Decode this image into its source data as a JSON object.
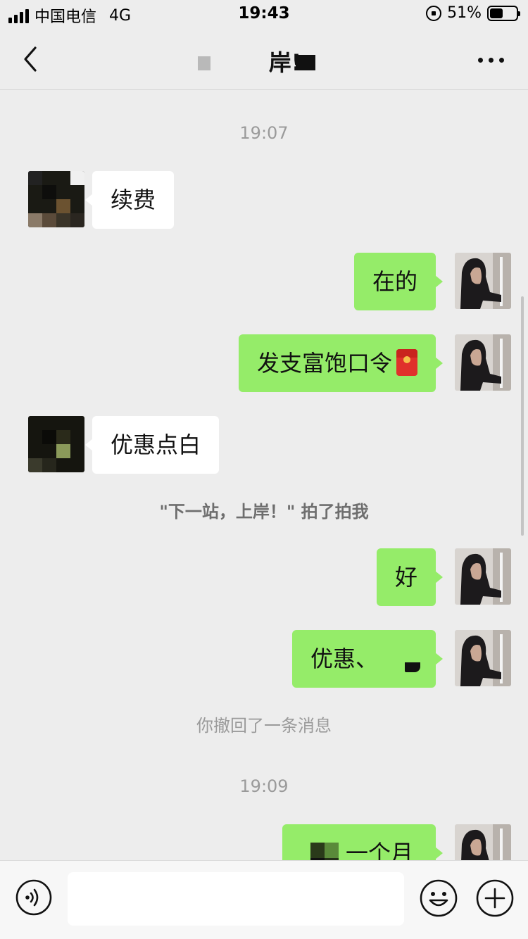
{
  "status_bar": {
    "carrier": "中国电信",
    "network": "4G",
    "time": "19:43",
    "battery": "51%",
    "battery_level": 0.51
  },
  "nav": {
    "title": "岸!"
  },
  "chat": {
    "timestamps": [
      "19:07",
      "19:09"
    ],
    "messages": [
      {
        "side": "in",
        "text": "续费"
      },
      {
        "side": "out",
        "text": "在的"
      },
      {
        "side": "out",
        "text": "发支富饱口令"
      },
      {
        "side": "in",
        "text": "优惠点白"
      },
      {
        "side": "out",
        "text": "好"
      },
      {
        "side": "out",
        "text": "优惠、"
      },
      {
        "side": "out",
        "text": "一个月"
      }
    ],
    "pat_notice": "\"下一站，上岸！\" 拍了拍我",
    "recall_notice": "你撤回了一条消息"
  },
  "input": {
    "value": "",
    "placeholder": ""
  },
  "colors": {
    "background": "#ededed",
    "outgoing_bubble": "#95ec69",
    "incoming_bubble": "#ffffff"
  },
  "icons": [
    "back-icon",
    "more-icon",
    "voice-icon",
    "emoji-icon",
    "plus-icon",
    "red-envelope-icon"
  ]
}
